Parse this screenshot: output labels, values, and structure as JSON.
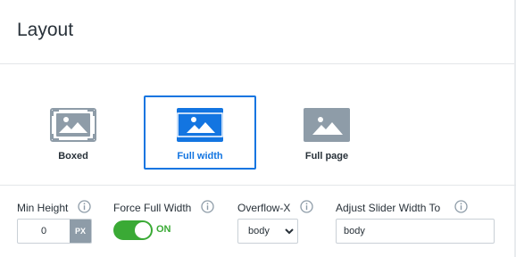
{
  "header": {
    "title": "Layout"
  },
  "layout_options": [
    {
      "label": "Boxed",
      "icon": "boxed-layout-icon",
      "selected": false
    },
    {
      "label": "Full width",
      "icon": "full-width-layout-icon",
      "selected": true
    },
    {
      "label": "Full page",
      "icon": "full-page-layout-icon",
      "selected": false
    }
  ],
  "fields": {
    "min_height": {
      "label": "Min Height",
      "value": "0",
      "unit": "PX"
    },
    "force_full_width": {
      "label": "Force Full Width",
      "state": "ON",
      "on": true
    },
    "overflow_x": {
      "label": "Overflow-X",
      "value": "body"
    },
    "adjust_slider_width": {
      "label": "Adjust Slider Width To",
      "value": "body"
    }
  },
  "colors": {
    "accent": "#1375e1",
    "icon_gray": "#8e9ca8",
    "toggle_green": "#3aaa35",
    "text": "#283139"
  }
}
